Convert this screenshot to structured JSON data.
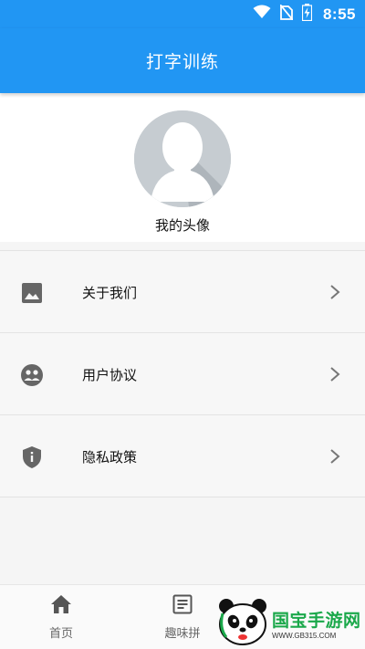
{
  "status_bar": {
    "time": "8:55",
    "icons": [
      "wifi-icon",
      "no-sim-icon",
      "battery-charging-icon"
    ]
  },
  "app_bar": {
    "title": "打字训练"
  },
  "profile": {
    "avatar_label": "我的头像"
  },
  "menu": {
    "items": [
      {
        "label": "关于我们",
        "icon": "image-icon"
      },
      {
        "label": "用户协议",
        "icon": "group-icon"
      },
      {
        "label": "隐私政策",
        "icon": "shield-icon"
      }
    ]
  },
  "bottom_nav": {
    "items": [
      {
        "label": "首页",
        "icon": "home-icon"
      },
      {
        "label": "趣味拼",
        "icon": "article-icon"
      }
    ]
  },
  "watermark": {
    "title": "国宝手游网",
    "url": "WWW.GB315.COM"
  },
  "colors": {
    "primary": "#2196f3",
    "icon_gray": "#666666",
    "chevron_gray": "#777777"
  }
}
